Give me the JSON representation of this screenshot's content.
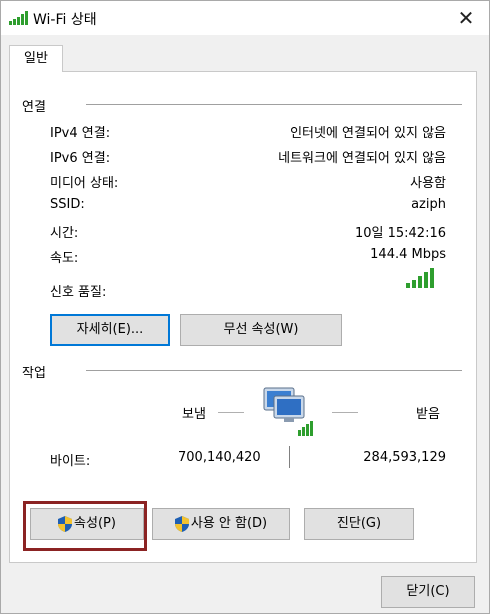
{
  "window": {
    "title": "Wi-Fi 상태",
    "close_label": "✕"
  },
  "tabs": [
    {
      "label": "일반"
    }
  ],
  "connection": {
    "section_title": "연결",
    "rows": [
      {
        "label": "IPv4 연결:",
        "value": "인터넷에 연결되어 있지 않음"
      },
      {
        "label": "IPv6 연결:",
        "value": "네트워크에 연결되어 있지 않음"
      },
      {
        "label": "미디어 상태:",
        "value": "사용함"
      },
      {
        "label": "SSID:",
        "value": "aziph"
      },
      {
        "label": "시간:",
        "value": "10일 15:42:16"
      },
      {
        "label": "속도:",
        "value": "144.4 Mbps"
      }
    ],
    "signal_label": "신호 품질:",
    "signal_bars": 5,
    "details_button": "자세히(E)...",
    "wireless_props_button": "무선 속성(W)"
  },
  "activity": {
    "section_title": "작업",
    "sent_label": "보냄",
    "received_label": "받음",
    "bytes_label": "바이트:",
    "bytes_sent": "700,140,420",
    "bytes_received": "284,593,129"
  },
  "bottom_buttons": {
    "properties": "속성(P)",
    "disable": "사용 안 함(D)",
    "diagnose": "진단(G)"
  },
  "close_button": "닫기(C)",
  "colors": {
    "signal": "#2e9e2e",
    "highlight": "#8b2323",
    "focus": "#0078d7"
  }
}
